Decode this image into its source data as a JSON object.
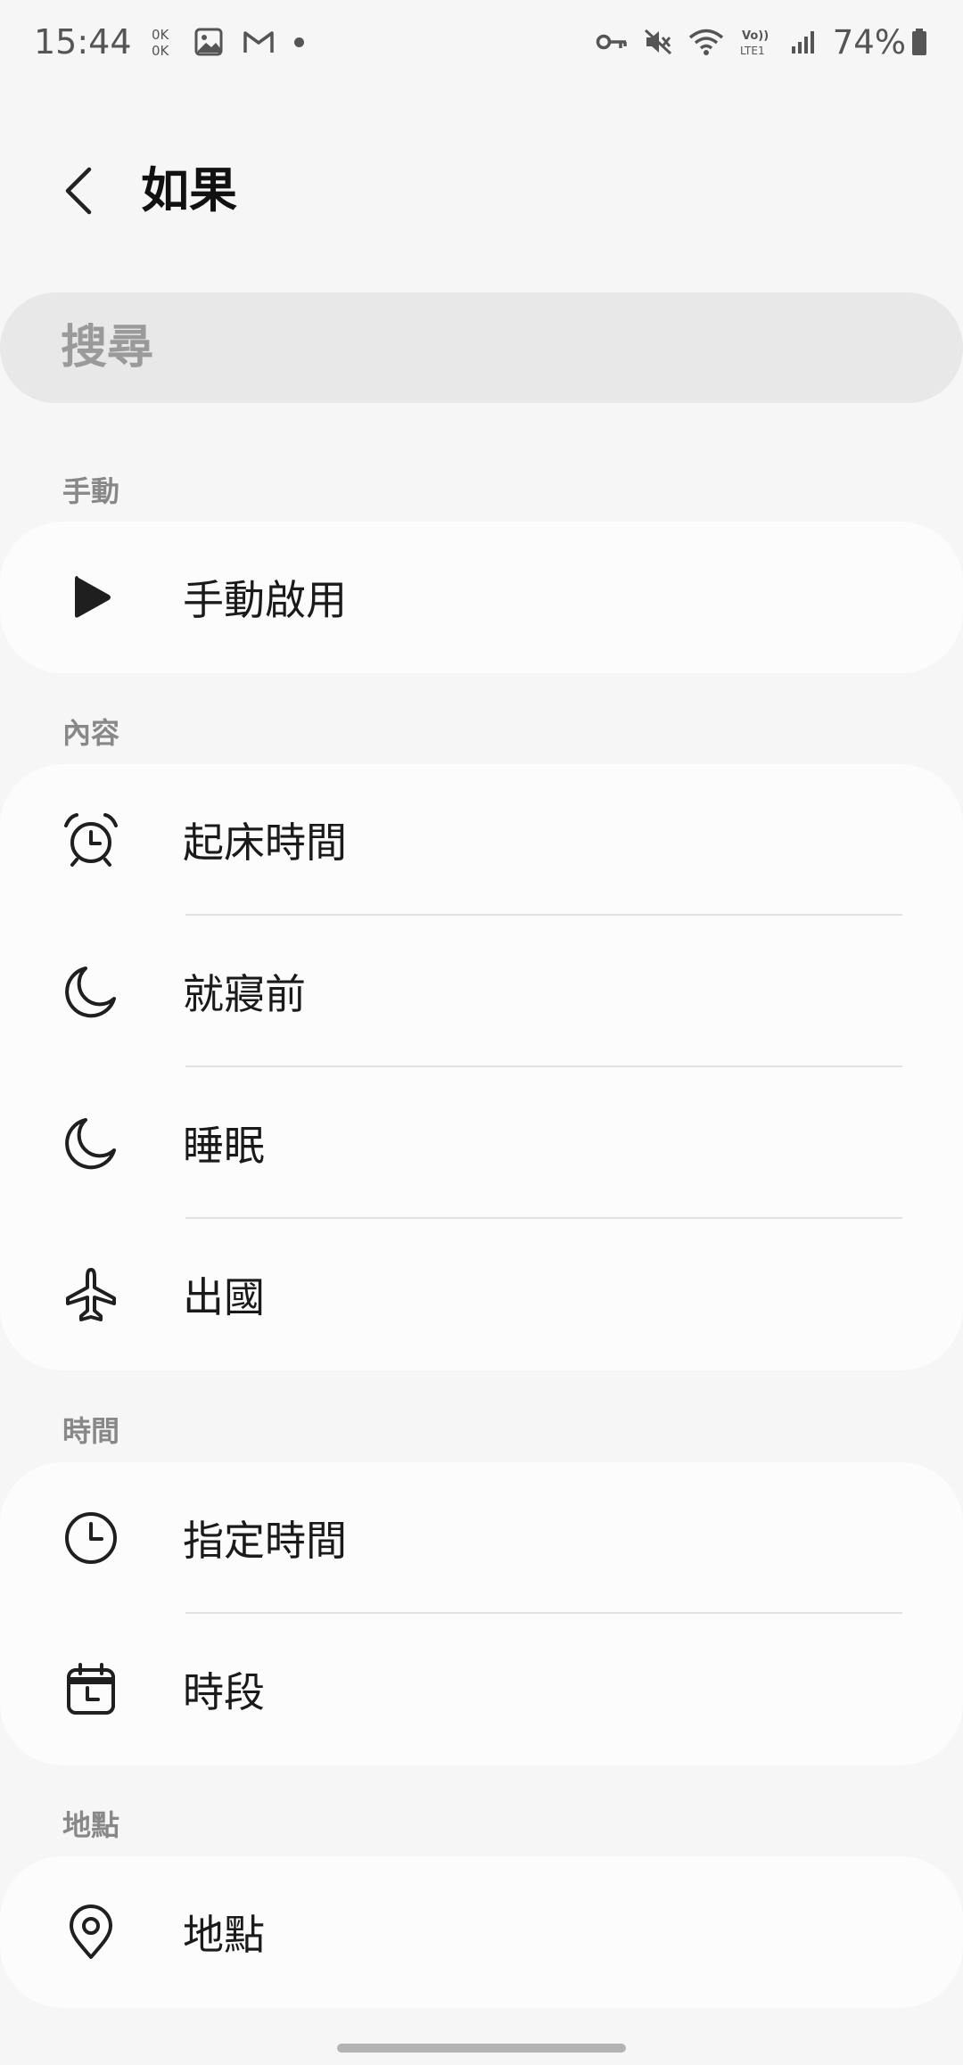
{
  "status_bar": {
    "time": "15:44",
    "battery_percent": "74%",
    "network_label": "Vo)) LTE1"
  },
  "header": {
    "title": "如果"
  },
  "search": {
    "placeholder": "搜尋"
  },
  "sections": {
    "manual": {
      "title": "手動",
      "items": [
        {
          "label": "手動啟用",
          "icon": "play-icon"
        }
      ]
    },
    "content": {
      "title": "內容",
      "items": [
        {
          "label": "起床時間",
          "icon": "alarm-clock-icon"
        },
        {
          "label": "就寢前",
          "icon": "moon-icon"
        },
        {
          "label": "睡眠",
          "icon": "moon-icon"
        },
        {
          "label": "出國",
          "icon": "airplane-icon"
        }
      ]
    },
    "time": {
      "title": "時間",
      "items": [
        {
          "label": "指定時間",
          "icon": "clock-icon"
        },
        {
          "label": "時段",
          "icon": "calendar-clock-icon"
        }
      ]
    },
    "location": {
      "title": "地點",
      "items": [
        {
          "label": "地點",
          "icon": "location-pin-icon"
        }
      ]
    }
  }
}
